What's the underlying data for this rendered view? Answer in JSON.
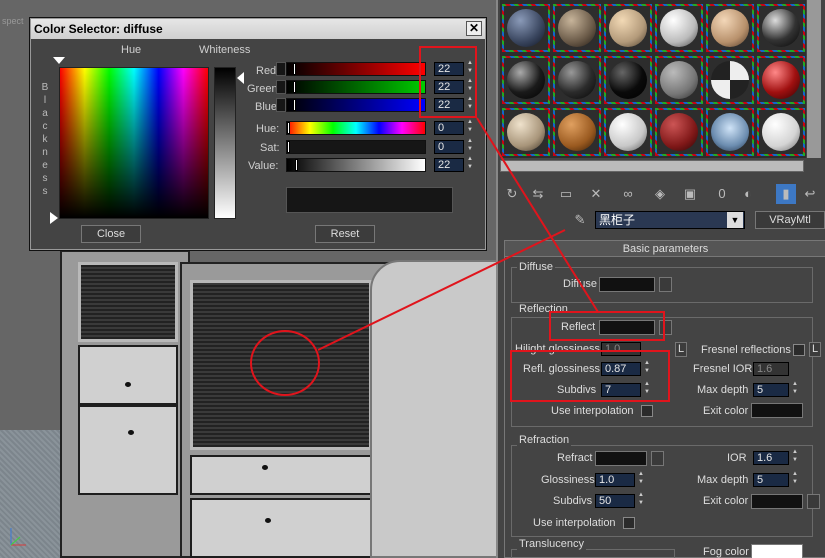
{
  "viewport": {
    "label": "spect"
  },
  "color_selector": {
    "title": "Color Selector: diffuse",
    "close_glyph": "✕",
    "hue_label": "Hue",
    "whiteness_label": "Whiteness",
    "blackness_label": "B l a c k n e s s",
    "rows": [
      {
        "label": "Red:",
        "value": "22"
      },
      {
        "label": "Green:",
        "value": "22"
      },
      {
        "label": "Blue:",
        "value": "22"
      },
      {
        "label": "Hue:",
        "value": "0"
      },
      {
        "label": "Sat:",
        "value": "0"
      },
      {
        "label": "Value:",
        "value": "22"
      }
    ],
    "close_button": "Close",
    "reset_button": "Reset",
    "current_color": "#161616"
  },
  "material_editor": {
    "material_name": "黑柜子",
    "material_type": "VRayMtl",
    "rollout_title": "Basic parameters",
    "diffuse": {
      "group": "Diffuse",
      "label": "Diffuse"
    },
    "reflection": {
      "group": "Reflection",
      "reflect_label": "Reflect",
      "hilight_glossiness_label": "Hilight glossiness",
      "hilight_glossiness_value": "1.0",
      "hilight_lock": "L",
      "fresnel_label": "Fresnel reflections",
      "fresnel_lock": "L",
      "fresnel_ior_label": "Fresnel IOR",
      "fresnel_ior_value": "1.6",
      "refl_glossiness_label": "Refl. glossiness",
      "refl_glossiness_value": "0.87",
      "subdivs_label": "Subdivs",
      "subdivs_value": "7",
      "max_depth_label": "Max depth",
      "max_depth_value": "5",
      "use_interp_label": "Use interpolation",
      "exit_color_label": "Exit color"
    },
    "refraction": {
      "group": "Refraction",
      "refract_label": "Refract",
      "ior_label": "IOR",
      "ior_value": "1.6",
      "glossiness_label": "Glossiness",
      "glossiness_value": "1.0",
      "max_depth_label": "Max depth",
      "max_depth_value": "5",
      "subdivs_label": "Subdivs",
      "subdivs_value": "50",
      "exit_color_label": "Exit color",
      "use_interp_label": "Use interpolation"
    },
    "translucency": {
      "group": "Translucency",
      "fog_color_label": "Fog color"
    },
    "toolbar_icons": [
      "get-material-icon",
      "put-material-icon",
      "assign-icon",
      "delete-icon",
      "unique-icon",
      "put-library-icon",
      "material-effects-icon",
      "show-map-icon",
      "show-end-icon",
      "go-parent-icon",
      "go-sibling-icon"
    ],
    "toolbar_zero": "0"
  }
}
